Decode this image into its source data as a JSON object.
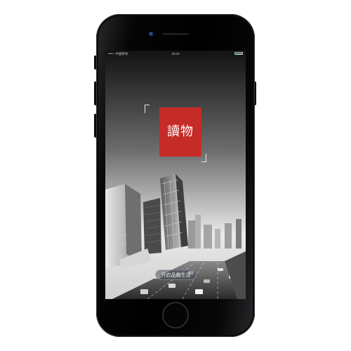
{
  "status_bar": {
    "carrier": "••••○ 中国移动",
    "wifi_icon": "wifi-icon",
    "time": "20:43",
    "battery_level": 1.0,
    "battery_color": "#4cd964"
  },
  "splash": {
    "logo_text": "讀物",
    "logo_color": "#c52b27",
    "start_button_label": "开启品趣生活"
  },
  "device": {
    "model_color": "#000000"
  }
}
